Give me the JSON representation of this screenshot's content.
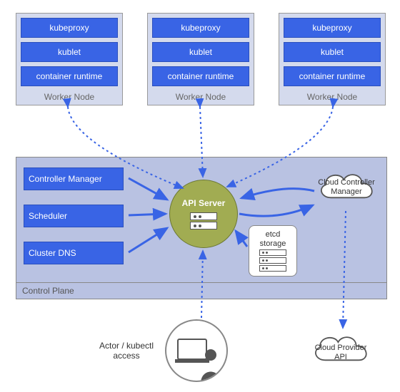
{
  "worker_nodes": [
    {
      "label": "Worker Node",
      "components": [
        "kubeproxy",
        "kublet",
        "container runtime"
      ]
    },
    {
      "label": "Worker Node",
      "components": [
        "kubeproxy",
        "kublet",
        "container runtime"
      ]
    },
    {
      "label": "Worker Node",
      "components": [
        "kubeproxy",
        "kublet",
        "container runtime"
      ]
    }
  ],
  "control_plane": {
    "label": "Control Plane",
    "left_components": [
      "Controller Manager",
      "Scheduler",
      "Cluster DNS"
    ],
    "api_server": "API Server",
    "etcd": "etcd storage",
    "ccm": "Cloud Controller Manager"
  },
  "actor": {
    "label": "Actor / kubectl access"
  },
  "cloud_provider": "Cloud Provider API"
}
